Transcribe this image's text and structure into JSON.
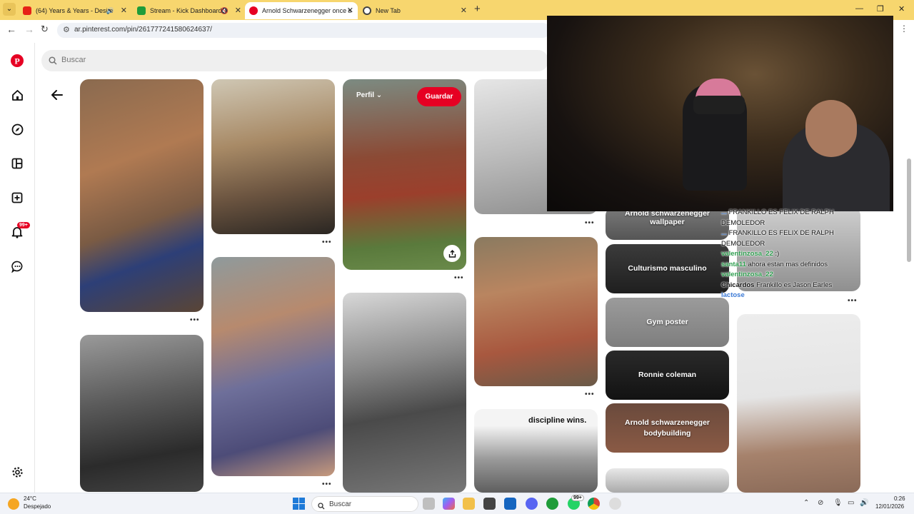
{
  "browser": {
    "tabs": [
      {
        "title": "(64) Years & Years - Desire",
        "fav_color": "#e62117",
        "active": false,
        "audio": true
      },
      {
        "title": "Stream - Kick Dashboard",
        "fav_color": "#1f9c3a",
        "active": false,
        "audio": true
      },
      {
        "title": "Arnold Schwarzenegger once s",
        "fav_color": "#e60023",
        "active": true,
        "audio": false
      },
      {
        "title": "New Tab",
        "fav_color": "#444444",
        "active": false,
        "audio": false
      }
    ],
    "url": "ar.pinterest.com/pin/261777241580624637/"
  },
  "pinterest": {
    "search_placeholder": "Buscar",
    "notification_badge": "99+",
    "save_button": "Guardar",
    "profile_dropdown": "Perfil",
    "discipline_text": "discipline wins.",
    "related_searches": [
      "Arnold schwarzenegger wallpaper",
      "Culturismo masculino",
      "Gym poster",
      "Ronnie coleman",
      "Arnold schwarzenegger bodybuilding"
    ]
  },
  "chat": [
    {
      "user": "...",
      "msg": "FRANKILLO ES FELIX DE RALPH DEMOLEDOR",
      "blue": true
    },
    {
      "user": "...",
      "msg": "FRANKILLO ES FELIX DE RALPH DEMOLEDOR",
      "blue": true
    },
    {
      "user": "valentinzosa_22",
      "msg": ":)",
      "blue": false
    },
    {
      "user": "santa11",
      "msg": "ahora estan mas definidos",
      "blue": false
    },
    {
      "user": "valentinzosa_22",
      "msg": "",
      "blue": false
    },
    {
      "user": "Chicardos",
      "msg": "Frankillo es Jason Earles",
      "blue": false
    },
    {
      "user": "lactose",
      "msg": "",
      "blue": true
    }
  ],
  "taskbar": {
    "search_label": "Buscar",
    "weather_temp": "24°C",
    "weather_desc": "Despejado",
    "time": "0:26",
    "date": "12/01/2026",
    "whatsapp_badge": "99+"
  },
  "colors": {
    "pinterest_red": "#e60023",
    "tabbar": "#f7d66e"
  }
}
